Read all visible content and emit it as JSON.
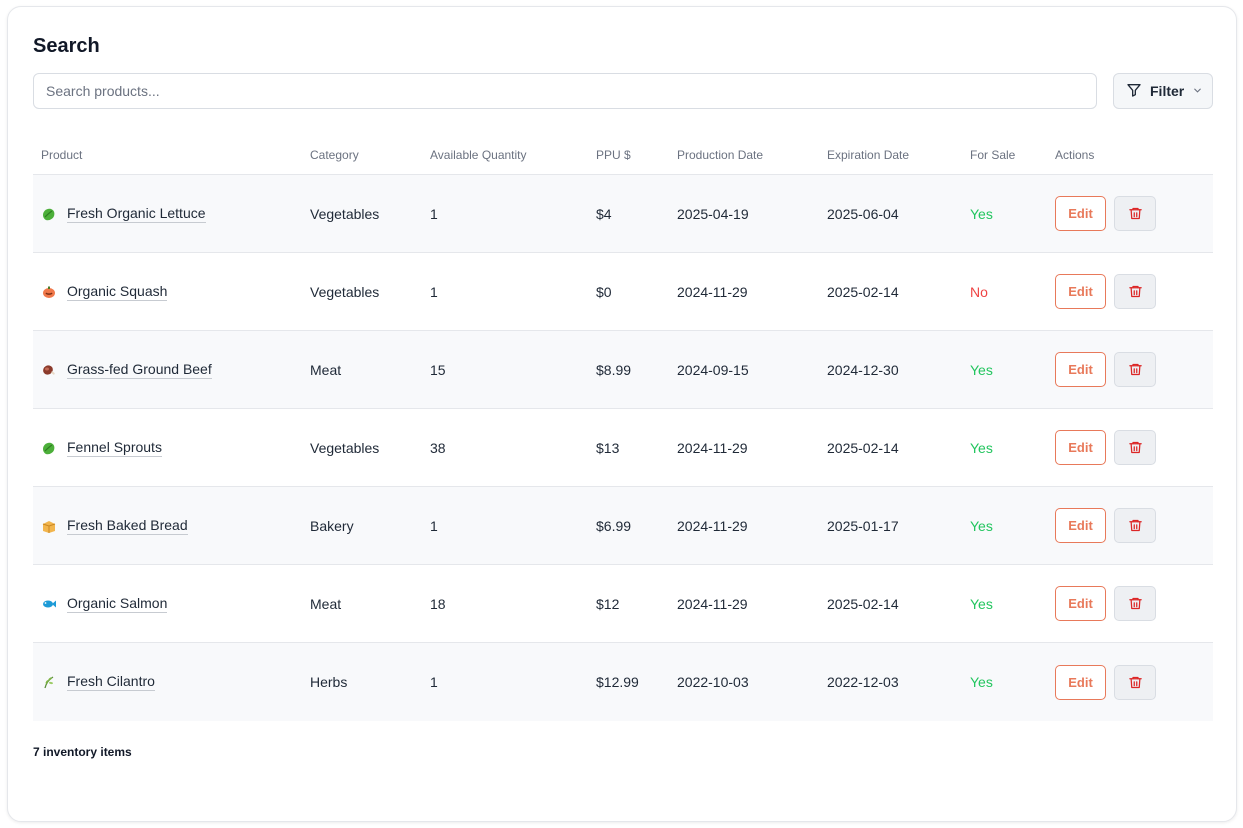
{
  "page": {
    "title": "Search"
  },
  "search": {
    "placeholder": "Search products..."
  },
  "filter": {
    "label": "Filter"
  },
  "table": {
    "headers": [
      "Product",
      "Category",
      "Available Quantity",
      "PPU $",
      "Production Date",
      "Expiration Date",
      "For Sale",
      "Actions"
    ],
    "rows": [
      {
        "icon": "lettuce-icon",
        "product": "Fresh Organic Lettuce",
        "category": "Vegetables",
        "quantity": "1",
        "ppu": "$4",
        "production": "2025-04-19",
        "expiration": "2025-06-04",
        "for_sale": "Yes"
      },
      {
        "icon": "squash-icon",
        "product": "Organic Squash",
        "category": "Vegetables",
        "quantity": "1",
        "ppu": "$0",
        "production": "2024-11-29",
        "expiration": "2025-02-14",
        "for_sale": "No"
      },
      {
        "icon": "meat-icon",
        "product": "Grass-fed Ground Beef",
        "category": "Meat",
        "quantity": "15",
        "ppu": "$8.99",
        "production": "2024-09-15",
        "expiration": "2024-12-30",
        "for_sale": "Yes"
      },
      {
        "icon": "lettuce-icon",
        "product": "Fennel Sprouts",
        "category": "Vegetables",
        "quantity": "38",
        "ppu": "$13",
        "production": "2024-11-29",
        "expiration": "2025-02-14",
        "for_sale": "Yes"
      },
      {
        "icon": "bread-icon",
        "product": "Fresh Baked Bread",
        "category": "Bakery",
        "quantity": "1",
        "ppu": "$6.99",
        "production": "2024-11-29",
        "expiration": "2025-01-17",
        "for_sale": "Yes"
      },
      {
        "icon": "fish-icon",
        "product": "Organic Salmon",
        "category": "Meat",
        "quantity": "18",
        "ppu": "$12",
        "production": "2024-11-29",
        "expiration": "2025-02-14",
        "for_sale": "Yes"
      },
      {
        "icon": "herb-icon",
        "product": "Fresh Cilantro",
        "category": "Herbs",
        "quantity": "1",
        "ppu": "$12.99",
        "production": "2022-10-03",
        "expiration": "2022-12-03",
        "for_sale": "Yes"
      }
    ],
    "edit_label": "Edit"
  },
  "footer": {
    "count_text": "7 inventory items"
  },
  "colors": {
    "yes": "#22c55e",
    "no": "#ef4444",
    "edit": "#e8795a",
    "delete_icon": "#dc2626"
  }
}
